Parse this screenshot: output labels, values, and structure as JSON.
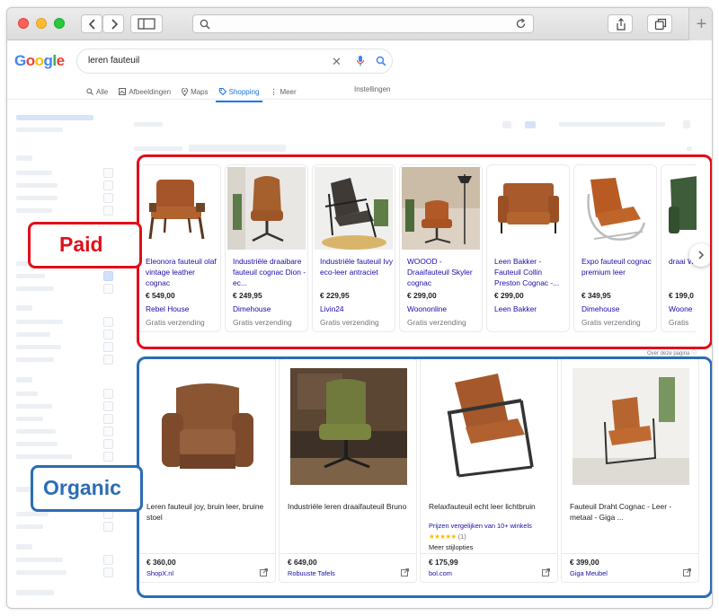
{
  "search": {
    "query": "leren fauteuil",
    "logo": "Google"
  },
  "tabs": [
    {
      "label": "Alle",
      "icon": "search-icon"
    },
    {
      "label": "Afbeeldingen",
      "icon": "image-icon"
    },
    {
      "label": "Maps",
      "icon": "map-pin-icon"
    },
    {
      "label": "Shopping",
      "icon": "tag-icon",
      "active": true
    },
    {
      "label": "Meer",
      "icon": "more-vert-icon"
    }
  ],
  "settings_label": "Instellingen",
  "annotations": {
    "paid_label": "Paid",
    "organic_label": "Organic",
    "paid_color": "#e0101a",
    "organic_color": "#2a6db6"
  },
  "paid_products": [
    {
      "title": "Eleonora fauteuil olaf vintage leather cognac",
      "price": "€ 549,00",
      "shop": "Rebel House",
      "shipping": "Gratis verzending"
    },
    {
      "title": "Industriële draaibare fauteuil cognac Dion - ec...",
      "price": "€ 249,95",
      "shop": "Dimehouse",
      "shipping": "Gratis verzending"
    },
    {
      "title": "Industriële fauteuil Ivy eco-leer antraciet",
      "price": "€ 229,95",
      "shop": "Livin24",
      "shipping": "Gratis verzending"
    },
    {
      "title": "WOOOD - Draaifauteuil Skyler cognac",
      "price": "€ 299,00",
      "shop": "Woononline",
      "shipping": "Gratis verzending"
    },
    {
      "title": "Leen Bakker - Fauteuil Collin Preston Cognac -...",
      "price": "€ 299,00",
      "shop": "Leen Bakker",
      "shipping": ""
    },
    {
      "title": "Expo fauteuil cognac premium leer",
      "price": "€ 349,95",
      "shop": "Dimehouse",
      "shipping": "Gratis verzending"
    },
    {
      "title": "draai WOUW",
      "price": "€ 199,0",
      "shop": "Woone",
      "shipping": "Gratis"
    }
  ],
  "about_page": "Over deze pagina",
  "organic_products": [
    {
      "title": "Leren fauteuil joy, bruin leer, bruine stoel",
      "price": "€ 360,00",
      "shop": "ShopX.nl",
      "compare": "",
      "rating": "",
      "more": ""
    },
    {
      "title": "Industriële leren draaifauteuil Bruno",
      "price": "€ 649,00",
      "shop": "Robuuste Tafels",
      "compare": "",
      "rating": "",
      "more": ""
    },
    {
      "title": "Relaxfauteuil echt leer lichtbruin",
      "price": "€ 175,99",
      "shop": "bol.com",
      "compare": "Prijzen vergelijken van 10+ winkels",
      "rating": "(1)",
      "stars": "★★★★★",
      "more": "Meer stijlopties"
    },
    {
      "title": "Fauteuil Draht Cognac - Leer - metaal - Giga ...",
      "price": "€ 399,00",
      "shop": "Giga Meubel",
      "compare": "",
      "rating": "",
      "more": ""
    }
  ]
}
